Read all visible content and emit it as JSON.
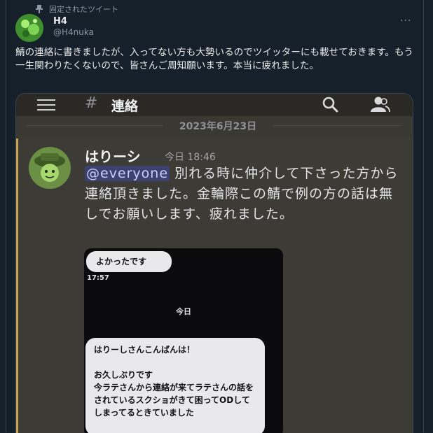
{
  "tweet": {
    "pinned_label": "固定されたツイート",
    "author_name": "H4",
    "author_handle": "@H4nuka",
    "more_label": "···",
    "text": "鯖の連絡に書きましたが、入ってない方も大勢いるのでツイッターにも載せておきます。もう一生関わりたくないので、皆さんご周知願います。本当に疲れました。"
  },
  "discord": {
    "hash": "#",
    "channel_name": "連絡",
    "date_separator": "2023年6月23日",
    "message": {
      "author": "はりーシ",
      "timestamp": "今日 18:46",
      "mention": "@everyone",
      "text": " 別れる時に仲介して下さった方から連絡頂きました。金輪際この鯖で例の方の話は無しでお願いします、疲れました。"
    }
  },
  "screenshot": {
    "bubble1": "よかったです",
    "time": "17:57",
    "today": "今日",
    "bubble2": "はりーしさんこんばんは！\n\nお久しぶりです\n今ラテさんから連絡が来てラテさんの話をされているスクショがきて困ってODしてしまってるときていました"
  },
  "colors": {
    "twitter_bg": "#15202b",
    "discord_bg": "#3d3b35",
    "mention_bar": "#c9a64a",
    "mention_bg": "#3c4270"
  },
  "icons": [
    "pin-icon",
    "avatar",
    "more-icon",
    "hamburger-icon",
    "hash-icon",
    "search-icon",
    "members-icon"
  ]
}
